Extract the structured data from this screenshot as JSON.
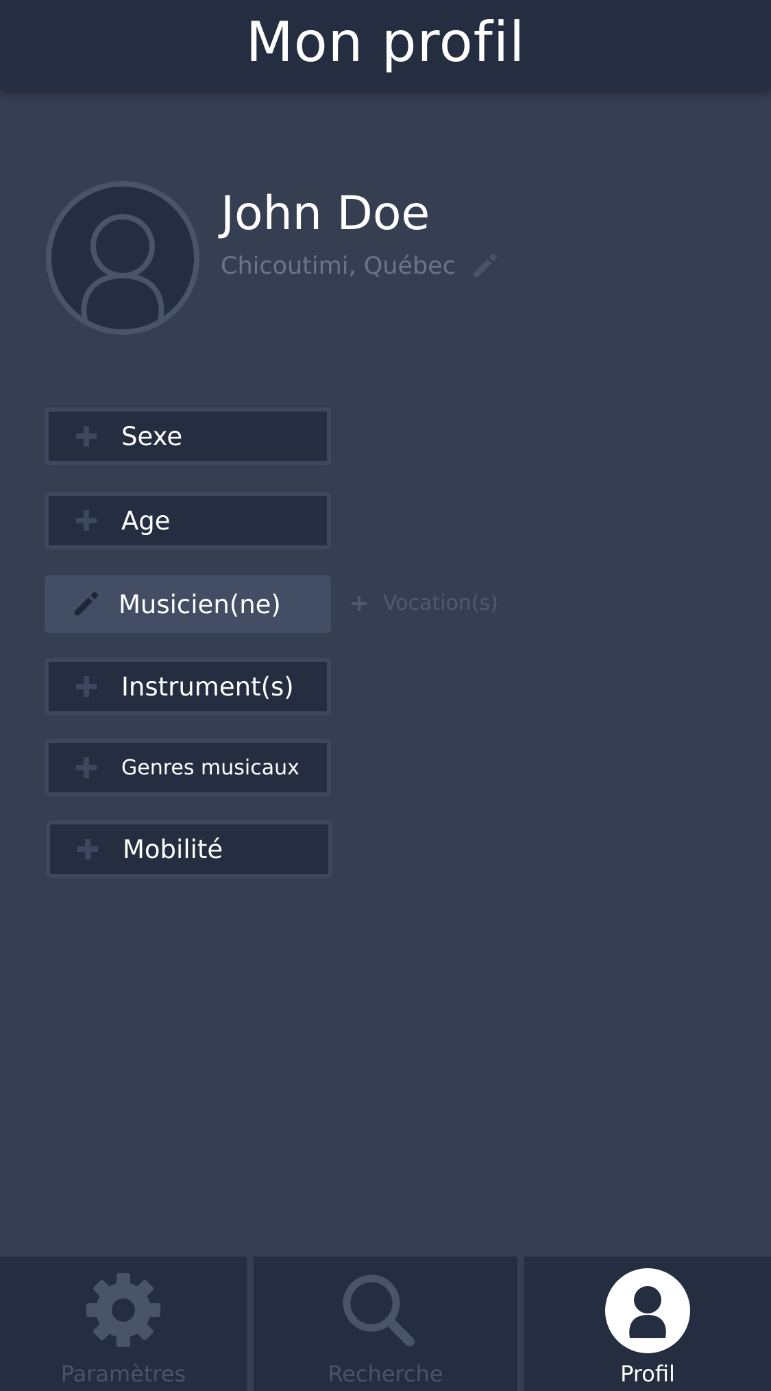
{
  "header": {
    "title": "Mon profil"
  },
  "profile": {
    "name": "John Doe",
    "location": "Chicoutimi, Québec"
  },
  "fields": {
    "sexe": "Sexe",
    "age": "Age",
    "musicien": "Musicien(ne)",
    "instruments": "Instrument(s)",
    "genres": "Genres musicaux",
    "mobilite": "Mobilité"
  },
  "vocation": {
    "label": "Vocation(s)"
  },
  "nav": {
    "items": [
      {
        "label": "Paramètres",
        "icon": "gear-icon",
        "active": false
      },
      {
        "label": "Recherche",
        "icon": "search-icon",
        "active": false
      },
      {
        "label": "Profil",
        "icon": "user-icon",
        "active": true
      }
    ]
  },
  "colors": {
    "background": "#363e52",
    "header": "#252d40",
    "button_fill": "#252d40",
    "button_border": "#3d475d",
    "selected_button": "#434d63",
    "muted_text": "#6c7588",
    "inactive_nav": "#4a5468"
  }
}
